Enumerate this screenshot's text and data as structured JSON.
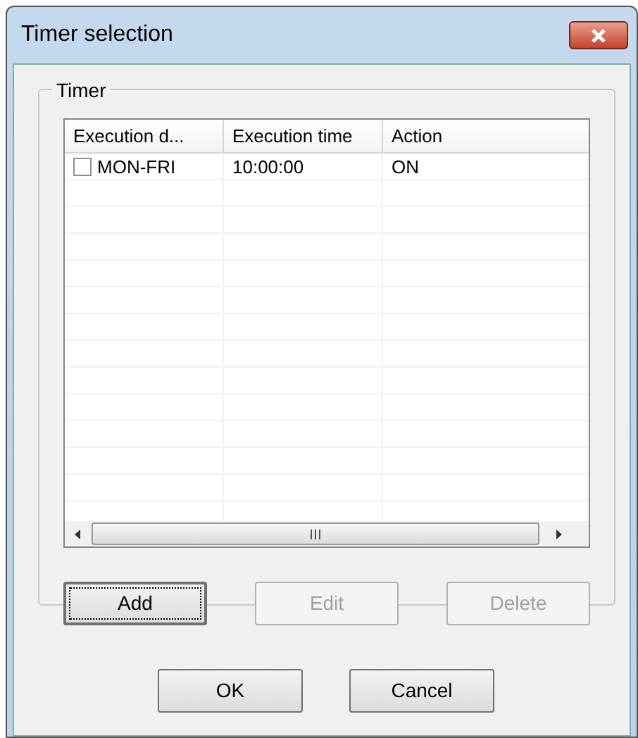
{
  "window": {
    "title": "Timer selection"
  },
  "group": {
    "label": "Timer"
  },
  "table": {
    "columns": [
      "Execution d...",
      "Execution time",
      "Action"
    ],
    "rows": [
      {
        "checked": false,
        "cells": [
          "MON-FRI",
          "10:00:00",
          "ON"
        ]
      }
    ]
  },
  "list_buttons": [
    {
      "label": "Add",
      "disabled": false,
      "focused": true
    },
    {
      "label": "Edit",
      "disabled": true,
      "focused": false
    },
    {
      "label": "Delete",
      "disabled": true,
      "focused": false
    }
  ],
  "dialog_buttons": [
    {
      "label": "OK"
    },
    {
      "label": "Cancel"
    }
  ]
}
